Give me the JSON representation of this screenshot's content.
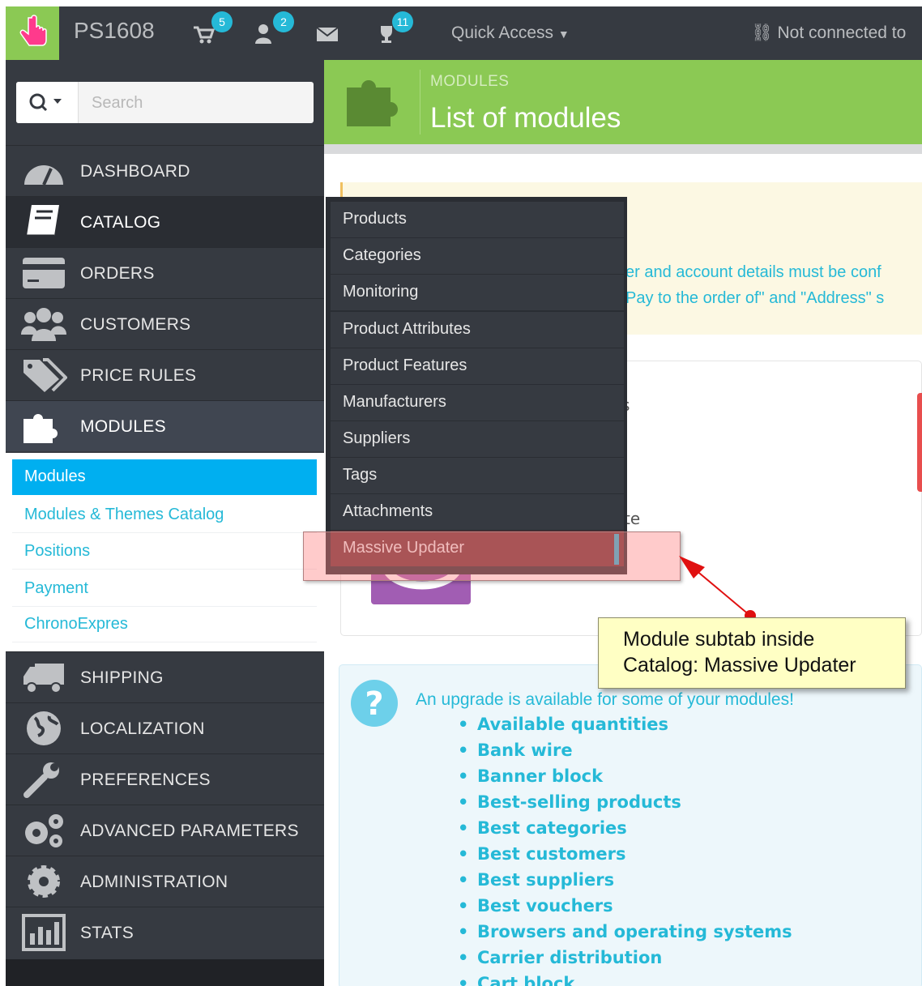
{
  "topbar": {
    "shop_name": "PS1608",
    "cart_badge": "5",
    "customers_badge": "2",
    "trophy_badge": "11",
    "quick_access": "Quick Access",
    "status": "Not connected to",
    "icons": [
      "hand-pointer-icon",
      "cart-icon",
      "user-icon",
      "envelope-icon",
      "trophy-icon",
      "caret-down-icon",
      "unlink-icon"
    ]
  },
  "search": {
    "placeholder": "Search"
  },
  "sidebar": {
    "items": [
      {
        "label": "DASHBOARD",
        "icon": "dashboard-icon"
      },
      {
        "label": "CATALOG",
        "icon": "book-icon"
      },
      {
        "label": "ORDERS",
        "icon": "credit-card-icon"
      },
      {
        "label": "CUSTOMERS",
        "icon": "users-icon"
      },
      {
        "label": "PRICE RULES",
        "icon": "tags-icon"
      },
      {
        "label": "MODULES",
        "icon": "puzzle-icon"
      },
      {
        "label": "SHIPPING",
        "icon": "truck-icon"
      },
      {
        "label": "LOCALIZATION",
        "icon": "globe-icon"
      },
      {
        "label": "PREFERENCES",
        "icon": "wrench-icon"
      },
      {
        "label": "ADVANCED PARAMETERS",
        "icon": "cogs-icon"
      },
      {
        "label": "ADMINISTRATION",
        "icon": "cog-icon"
      },
      {
        "label": "STATS",
        "icon": "bar-chart-icon"
      }
    ],
    "modules_sub": [
      "Modules",
      "Modules & Themes Catalog",
      "Positions",
      "Payment",
      "ChronoExpres"
    ]
  },
  "catalog_flyout": [
    "Products",
    "Categories",
    "Monitoring",
    "Product Attributes",
    "Product Features",
    "Manufacturers",
    "Suppliers",
    "Tags",
    "Attachments",
    "Massive Updater"
  ],
  "header": {
    "breadcrumb": "MODULES",
    "title": "List of modules"
  },
  "warning": {
    "line1": "er and account details must be conf",
    "line2": "Pay to the order of\" and \"Address\" s"
  },
  "module_panel": {
    "fragment1": "s",
    "fragment2": "te"
  },
  "upgrade": {
    "title": "An upgrade is available for some of your modules!",
    "modules": [
      "Available quantities",
      "Bank wire",
      "Banner block",
      "Best-selling products",
      "Best categories",
      "Best customers",
      "Best suppliers",
      "Best vouchers",
      "Browsers and operating systems",
      "Carrier distribution",
      "Cart block"
    ]
  },
  "annotation": {
    "line1": "Module subtab inside",
    "line2": "Catalog: Massive Updater"
  },
  "colors": {
    "accent": "#25b9d7",
    "header_green": "#8bc954",
    "sidebar": "#363a41",
    "active_sub": "#00aff0"
  }
}
